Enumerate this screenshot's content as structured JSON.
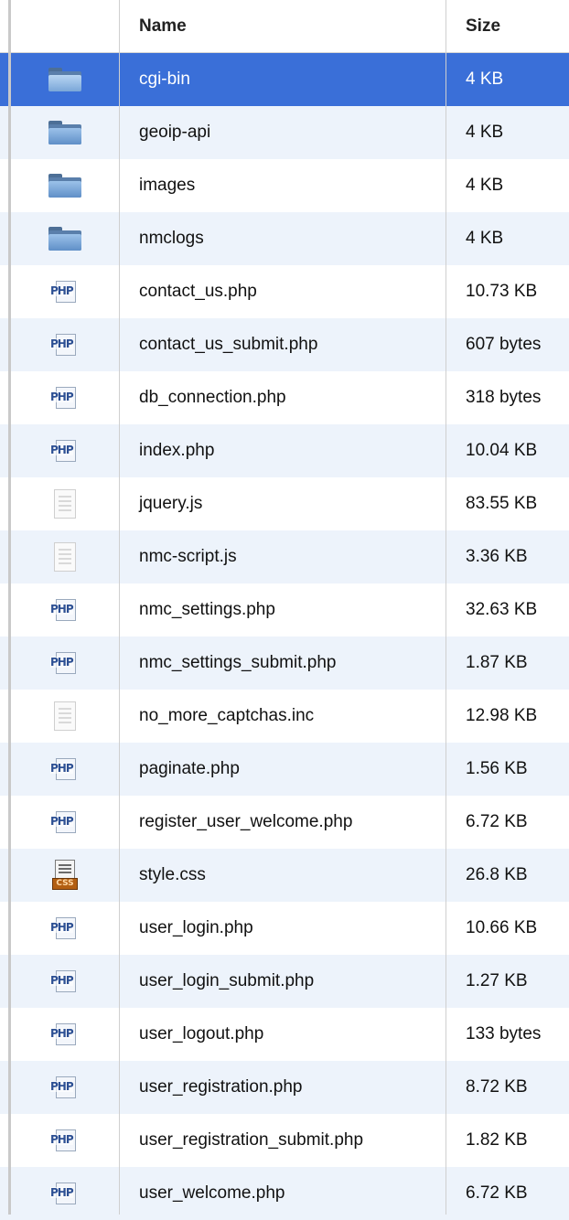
{
  "header": {
    "name_label": "Name",
    "size_label": "Size"
  },
  "colors": {
    "selected": "#3a6fd8",
    "alt_row": "#edf3fb"
  },
  "files": [
    {
      "name": "cgi-bin",
      "size": "4 KB",
      "icon": "folder-icon",
      "selected": true
    },
    {
      "name": "geoip-api",
      "size": "4 KB",
      "icon": "folder-icon"
    },
    {
      "name": "images",
      "size": "4 KB",
      "icon": "folder-icon"
    },
    {
      "name": "nmclogs",
      "size": "4 KB",
      "icon": "folder-icon"
    },
    {
      "name": "contact_us.php",
      "size": "10.73 KB",
      "icon": "php-file-icon"
    },
    {
      "name": "contact_us_submit.php",
      "size": "607 bytes",
      "icon": "php-file-icon"
    },
    {
      "name": "db_connection.php",
      "size": "318 bytes",
      "icon": "php-file-icon"
    },
    {
      "name": "index.php",
      "size": "10.04 KB",
      "icon": "php-file-icon"
    },
    {
      "name": "jquery.js",
      "size": "83.55 KB",
      "icon": "text-file-icon"
    },
    {
      "name": "nmc-script.js",
      "size": "3.36 KB",
      "icon": "text-file-icon"
    },
    {
      "name": "nmc_settings.php",
      "size": "32.63 KB",
      "icon": "php-file-icon"
    },
    {
      "name": "nmc_settings_submit.php",
      "size": "1.87 KB",
      "icon": "php-file-icon"
    },
    {
      "name": "no_more_captchas.inc",
      "size": "12.98 KB",
      "icon": "text-file-icon"
    },
    {
      "name": "paginate.php",
      "size": "1.56 KB",
      "icon": "php-file-icon"
    },
    {
      "name": "register_user_welcome.php",
      "size": "6.72 KB",
      "icon": "php-file-icon"
    },
    {
      "name": "style.css",
      "size": "26.8 KB",
      "icon": "css-file-icon"
    },
    {
      "name": "user_login.php",
      "size": "10.66 KB",
      "icon": "php-file-icon"
    },
    {
      "name": "user_login_submit.php",
      "size": "1.27 KB",
      "icon": "php-file-icon"
    },
    {
      "name": "user_logout.php",
      "size": "133 bytes",
      "icon": "php-file-icon"
    },
    {
      "name": "user_registration.php",
      "size": "8.72 KB",
      "icon": "php-file-icon"
    },
    {
      "name": "user_registration_submit.php",
      "size": "1.82 KB",
      "icon": "php-file-icon"
    },
    {
      "name": "user_welcome.php",
      "size": "6.72 KB",
      "icon": "php-file-icon"
    }
  ]
}
